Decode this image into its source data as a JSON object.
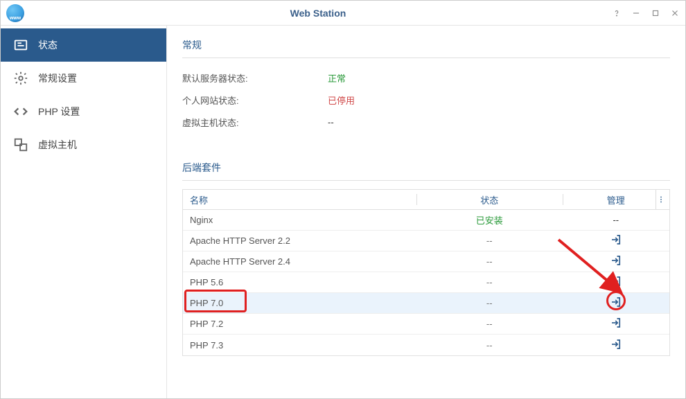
{
  "window": {
    "title": "Web Station"
  },
  "sidebar": {
    "items": [
      {
        "label": "状态",
        "icon": "status"
      },
      {
        "label": "常规设置",
        "icon": "gear"
      },
      {
        "label": "PHP 设置",
        "icon": "code"
      },
      {
        "label": "虚拟主机",
        "icon": "vhost"
      }
    ]
  },
  "sections": {
    "general": {
      "title": "常规",
      "rows": [
        {
          "label": "默认服务器状态:",
          "value": "正常",
          "cls": "status-green"
        },
        {
          "label": "个人网站状态:",
          "value": "已停用",
          "cls": "status-red"
        },
        {
          "label": "虚拟主机状态:",
          "value": "--",
          "cls": ""
        }
      ]
    },
    "backend": {
      "title": "后端套件",
      "headers": {
        "name": "名称",
        "status": "状态",
        "manage": "管理"
      },
      "rows": [
        {
          "name": "Nginx",
          "status": "已安装",
          "statusCls": "installed",
          "manage": "--"
        },
        {
          "name": "Apache HTTP Server 2.2",
          "status": "--",
          "manage": "icon"
        },
        {
          "name": "Apache HTTP Server 2.4",
          "status": "--",
          "manage": "icon"
        },
        {
          "name": "PHP 5.6",
          "status": "--",
          "manage": "icon"
        },
        {
          "name": "PHP 7.0",
          "status": "--",
          "manage": "icon",
          "highlight": true
        },
        {
          "name": "PHP 7.2",
          "status": "--",
          "manage": "icon"
        },
        {
          "name": "PHP 7.3",
          "status": "--",
          "manage": "icon"
        }
      ]
    }
  },
  "colors": {
    "accent": "#2a5a8c",
    "ok": "#2a9a3a",
    "err": "#d04848"
  }
}
